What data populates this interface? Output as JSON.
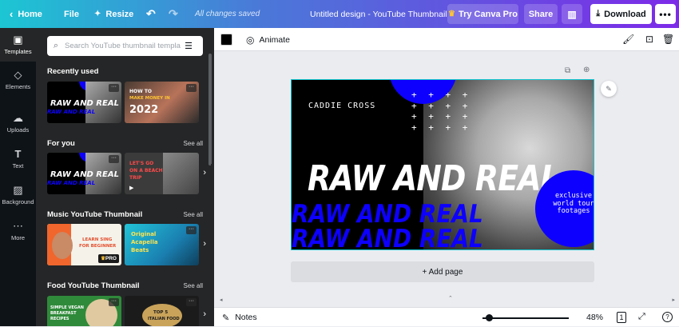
{
  "topbar": {
    "home_label": "Home",
    "file_label": "File",
    "resize_label": "Resize",
    "save_status": "All changes saved",
    "doc_title": "Untitled design - YouTube Thumbnail",
    "try_pro_label": "Try Canva Pro",
    "share_label": "Share",
    "download_label": "Download"
  },
  "rail": {
    "items": [
      {
        "label": "Templates",
        "icon": "templates-icon"
      },
      {
        "label": "Elements",
        "icon": "elements-icon"
      },
      {
        "label": "Uploads",
        "icon": "uploads-icon"
      },
      {
        "label": "Text",
        "icon": "text-icon"
      },
      {
        "label": "Background",
        "icon": "background-icon"
      },
      {
        "label": "More",
        "icon": "more-icon"
      }
    ]
  },
  "panel": {
    "search_placeholder": "Search YouTube thumbnail templates",
    "sections": [
      {
        "title": "Recently used",
        "see_all": ""
      },
      {
        "title": "For you",
        "see_all": "See all"
      },
      {
        "title": "Music YouTube Thumbnail",
        "see_all": "See all"
      },
      {
        "title": "Food YouTube Thumbnail",
        "see_all": "See all"
      }
    ],
    "thumbs": {
      "raw_and_real": "RAW AND REAL",
      "how_to_1": "HOW TO",
      "how_to_2": "MAKE MONEY IN",
      "how_to_3": "2022",
      "beach_1": "LET'S GO",
      "beach_2": "ON A BEACH",
      "beach_3": "TRIP",
      "sing_1": "LEARN SING",
      "sing_2": "FOR BEGINNER",
      "sing_badge": "PRO",
      "acapella_1": "Original",
      "acapella_2": "Acapella",
      "acapella_3": "Beats",
      "vegan_1": "SIMPLE VEGAN",
      "vegan_2": "BREAKFAST",
      "vegan_3": "RECIPES",
      "top5_1": "TOP 5",
      "top5_2": "ITALIAN FOOD"
    }
  },
  "toolbar": {
    "color": "#000000",
    "animate_label": "Animate"
  },
  "design": {
    "caddie": "CADDIE CROSS",
    "headline": "RAW AND REAL",
    "echo": "RAW AND REAL",
    "circle_text_1": "exclusive",
    "circle_text_2": "world tour",
    "circle_text_3": "footages",
    "accent": "#0d00ff",
    "plus_rows": [
      "+ + + +",
      "+ + + +",
      "+ + + +",
      "+ + + +"
    ]
  },
  "add_page_label": "+ Add page",
  "footer": {
    "notes_label": "Notes",
    "zoom_level": "48%",
    "page_count": "1"
  }
}
